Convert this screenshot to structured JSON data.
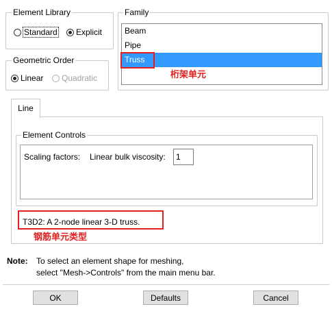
{
  "element_library": {
    "title": "Element Library",
    "options": [
      "Standard",
      "Explicit"
    ],
    "selected": "Explicit"
  },
  "geometric_order": {
    "title": "Geometric Order",
    "options": [
      "Linear",
      "Quadratic"
    ],
    "selected": "Linear",
    "disabled": [
      "Quadratic"
    ]
  },
  "family": {
    "title": "Family",
    "items": [
      "Beam",
      "Pipe",
      "Truss"
    ],
    "selected": "Truss",
    "annotation": "桁架单元"
  },
  "tabs": {
    "active": "Line"
  },
  "element_controls": {
    "title": "Element Controls",
    "scaling_label": "Scaling factors:",
    "viscosity_label": "Linear bulk viscosity:",
    "viscosity_value": "1"
  },
  "element_description": {
    "text": "T3D2:  A 2-node linear 3-D truss.",
    "annotation": "钢筋单元类型"
  },
  "note": {
    "label": "Note:",
    "line1": "To select an element shape for meshing,",
    "line2": "select \"Mesh->Controls\" from the main menu bar."
  },
  "buttons": {
    "ok": "OK",
    "defaults": "Defaults",
    "cancel": "Cancel"
  },
  "colors": {
    "selection": "#3399ff",
    "annotation": "#e02020",
    "border": "#c9c9c9"
  }
}
